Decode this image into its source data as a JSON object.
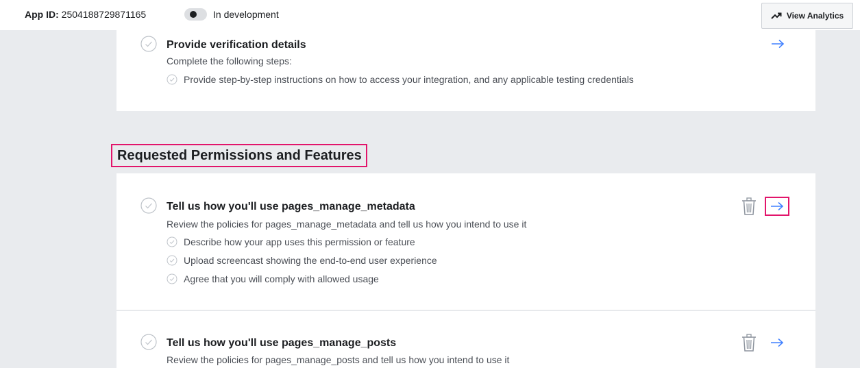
{
  "header": {
    "app_id_label": "App ID:",
    "app_id_value": "2504188729871165",
    "status_text": "In development",
    "analytics_button_label": "View Analytics",
    "analytics_icon": "trend-up-icon"
  },
  "verification": {
    "title": "Provide verification details",
    "description": "Complete the following steps:",
    "items": [
      "Provide step-by-step instructions on how to access your integration, and any applicable testing credentials"
    ]
  },
  "permissions_section": {
    "heading": "Requested Permissions and Features"
  },
  "permissions": [
    {
      "title": "Tell us how you'll use pages_manage_metadata",
      "description": "Review the policies for pages_manage_metadata and tell us how you intend to use it",
      "items": [
        "Describe how your app uses this permission or feature",
        "Upload screencast showing the end-to-end user experience",
        "Agree that you will comply with allowed usage"
      ]
    },
    {
      "title": "Tell us how you'll use pages_manage_posts",
      "description": "Review the policies for pages_manage_posts and tell us how you intend to use it"
    }
  ],
  "colors": {
    "accent_blue": "#4080ff",
    "highlight_pink": "#e2156b",
    "page_background": "#e9ebee"
  }
}
